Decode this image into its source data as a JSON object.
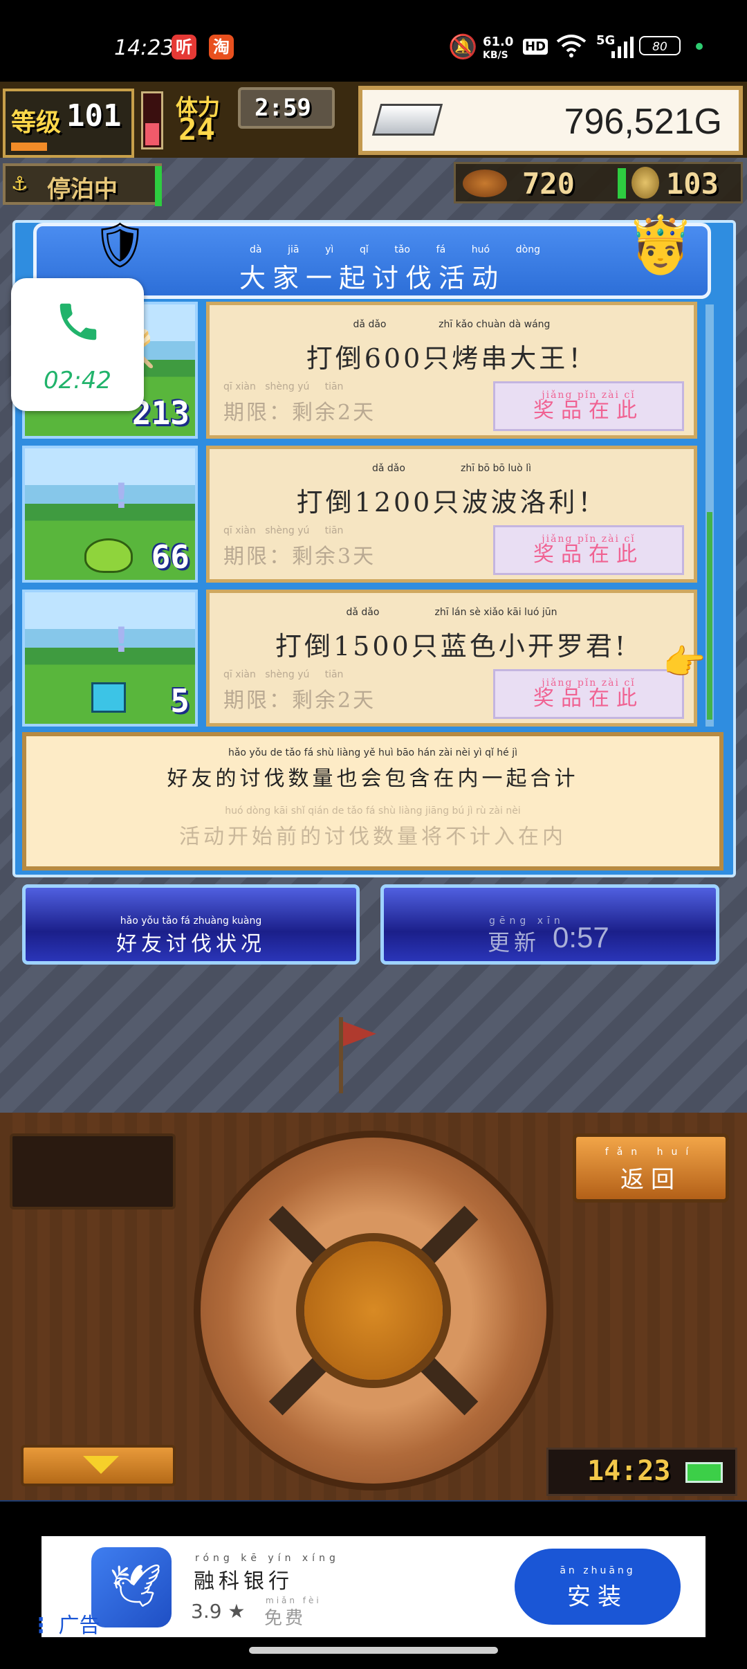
{
  "status_bar": {
    "time": "14:23",
    "network_speed_value": "61.0",
    "network_speed_unit": "KB/S",
    "hd": "HD",
    "signal": "5G",
    "battery": "80",
    "app_icon_1": "听",
    "app_icon_2": "淘"
  },
  "hud": {
    "level_label": "等级",
    "level_value": "101",
    "stamina_label": "体力",
    "stamina_value": "24",
    "timer": "2:59",
    "gold": "796,521G",
    "dock_status": "停泊中",
    "resource_1": "720",
    "resource_2": "103"
  },
  "panel": {
    "title_pinyin": [
      "dà",
      "jiā",
      "yì",
      "qǐ",
      "tǎo",
      "fá",
      "huó",
      "dòng"
    ],
    "title": "大家一起讨伐活动"
  },
  "missions": [
    {
      "title_pinyin": "dǎ dǎo                 zhī kǎo chuàn dà wáng",
      "title": "打倒600只烤串大王！",
      "deadline_pinyin": "qī xiàn   shèng yú     tiān",
      "deadline": "期限：剩余2天",
      "reward_pinyin": "jiǎng pǐn zài cǐ",
      "reward": "奖品在此",
      "count": "213"
    },
    {
      "title_pinyin": "dǎ dǎo                  zhī bō bō luò lì",
      "title": "打倒1200只波波洛利！",
      "deadline_pinyin": "qī xiàn   shèng yú     tiān",
      "deadline": "期限：剩余3天",
      "reward_pinyin": "jiǎng pǐn zài cǐ",
      "reward": "奖品在此",
      "count": "66"
    },
    {
      "title_pinyin": "dǎ dǎo                  zhī lán sè xiǎo kāi luó jūn",
      "title": "打倒1500只蓝色小开罗君!",
      "deadline_pinyin": "qī xiàn   shèng yú     tiān",
      "deadline": "期限：剩余2天",
      "reward_pinyin": "jiǎng pǐn zài cǐ",
      "reward": "奖品在此",
      "count": "5"
    }
  ],
  "info": {
    "line1_pinyin": "hǎo yǒu de tǎo fá shù liàng yě huì bāo hán zài nèi yì qǐ hé jì",
    "line1": "好友的讨伐数量也会包含在内一起合计",
    "line2_pinyin": "huó dòng kāi shǐ qián de tǎo fá shù liàng jiāng bú jì rù zài nèi",
    "line2": "活动开始前的讨伐数量将不计入在内"
  },
  "buttons": {
    "friend_status_pinyin": "hǎo yǒu tǎo fá zhuàng kuàng",
    "friend_status": "好友讨伐状况",
    "refresh_pinyin": "gēng xīn",
    "refresh_label": "更新",
    "refresh_time": "0:57",
    "back_pinyin": "fǎn huí",
    "back": "返回"
  },
  "console": {
    "clock": "14:23"
  },
  "call_overlay": {
    "duration": "02:42"
  },
  "ad": {
    "app_name_pinyin": "róng kē yín xíng",
    "app_name": "融科银行",
    "rating": "3.9 ★",
    "free_pinyin": "miǎn fèi",
    "free": "免费",
    "ad_label": "广告",
    "install_pinyin": "ān zhuāng",
    "install": "安装"
  },
  "colors": {
    "panel_blue": "#2f8de0",
    "card_cream": "#f6e5c2",
    "reward_pink": "#f06292",
    "install_blue": "#1a56d6",
    "call_green": "#21b36b"
  }
}
